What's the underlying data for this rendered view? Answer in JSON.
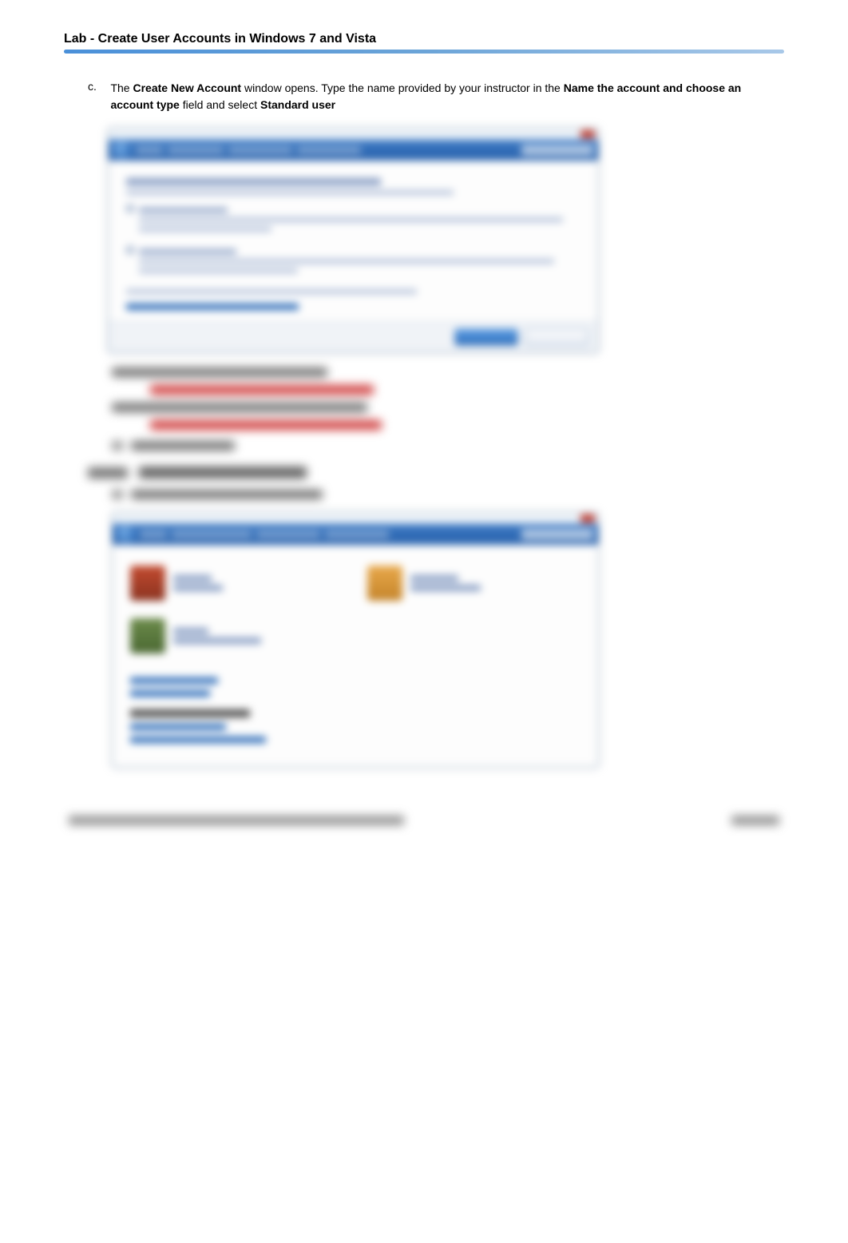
{
  "header": {
    "title": "Lab - Create User Accounts in Windows 7 and Vista"
  },
  "item": {
    "letter": "c.",
    "t1": "The ",
    "b1": "Create New Account",
    "t2": " window opens. Type the name provided by your instructor in the ",
    "b2": "Name the account and choose an account type",
    "t3": " field and select ",
    "b3": "Standard user"
  }
}
